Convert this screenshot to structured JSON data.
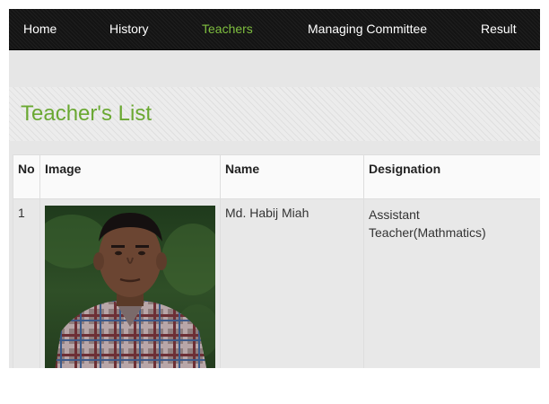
{
  "nav": {
    "items": [
      {
        "label": "Home",
        "active": false
      },
      {
        "label": "History",
        "active": false
      },
      {
        "label": "Teachers",
        "active": true
      },
      {
        "label": "Managing Committee",
        "active": false
      },
      {
        "label": "Result",
        "active": false
      }
    ]
  },
  "page": {
    "title": "Teacher's List"
  },
  "table": {
    "headers": [
      "No",
      "Image",
      "Name",
      "Designation"
    ],
    "rows": [
      {
        "no": "1",
        "name": "Md. Habij Miah",
        "designation": "Assistant Teacher(Mathmatics)"
      }
    ]
  },
  "colors": {
    "nav_bg": "#141414",
    "nav_active": "#7fbf3f",
    "title": "#6aa832",
    "table_border": "#dedede"
  }
}
